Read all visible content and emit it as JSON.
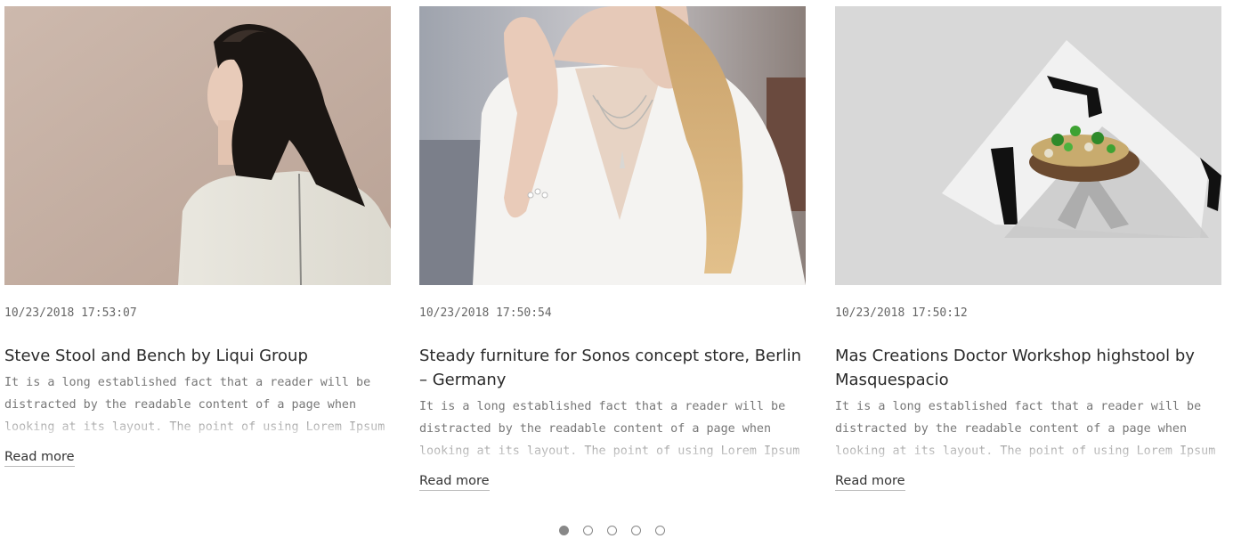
{
  "posts": [
    {
      "image_alt": "Woman with long dark hair in white top, back view",
      "date": "10/23/2018 17:53:07",
      "title": "Steve Stool and Bench by Liqui Group",
      "excerpt": "It is a long established fact that a reader will be distracted by the readable content of a page when looking at its layout. The point of using Lorem Ipsum is",
      "read_more": "Read more"
    },
    {
      "image_alt": "Woman with blonde hair wearing necklace and bracelet",
      "date": "10/23/2018 17:50:54",
      "title": "Steady furniture for Sonos concept store, Berlin – Germany",
      "excerpt": "It is a long established fact that a reader will be distracted by the readable content of a page when looking at its layout. The point of using Lorem Ipsum is",
      "read_more": "Read more"
    },
    {
      "image_alt": "Food on folded black and white patterned paper",
      "date": "10/23/2018 17:50:12",
      "title": "Mas Creations Doctor Workshop highstool by Masquespacio",
      "excerpt": "It is a long established fact that a reader will be distracted by the readable content of a page when looking at its layout. The point of using Lorem Ipsum is",
      "read_more": "Read more"
    }
  ],
  "pagination": {
    "count": 5,
    "active_index": 0
  },
  "colors": {
    "dot_active": "#888888",
    "text_muted": "#777777",
    "title": "#2a2a2a"
  }
}
